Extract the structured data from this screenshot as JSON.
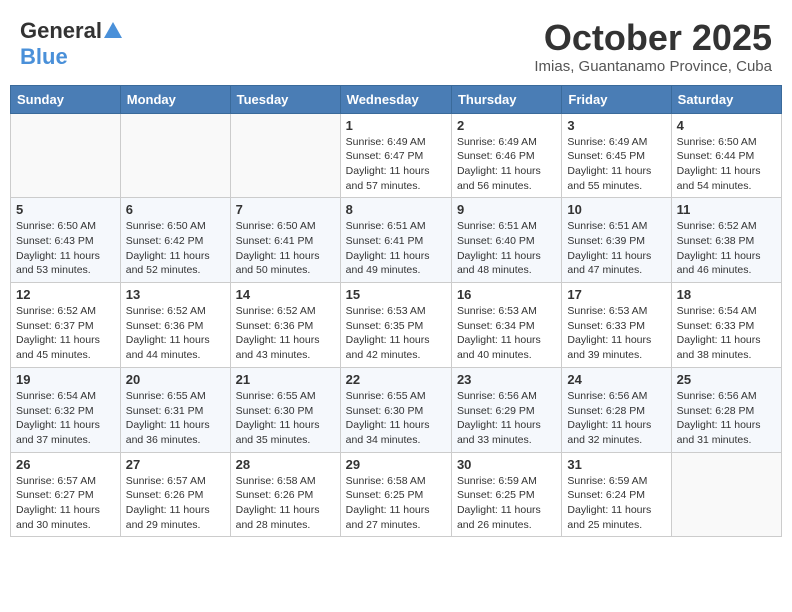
{
  "header": {
    "logo_general": "General",
    "logo_blue": "Blue",
    "month": "October 2025",
    "location": "Imias, Guantanamo Province, Cuba"
  },
  "days_of_week": [
    "Sunday",
    "Monday",
    "Tuesday",
    "Wednesday",
    "Thursday",
    "Friday",
    "Saturday"
  ],
  "weeks": [
    [
      {
        "day": "",
        "text": ""
      },
      {
        "day": "",
        "text": ""
      },
      {
        "day": "",
        "text": ""
      },
      {
        "day": "1",
        "text": "Sunrise: 6:49 AM\nSunset: 6:47 PM\nDaylight: 11 hours and 57 minutes."
      },
      {
        "day": "2",
        "text": "Sunrise: 6:49 AM\nSunset: 6:46 PM\nDaylight: 11 hours and 56 minutes."
      },
      {
        "day": "3",
        "text": "Sunrise: 6:49 AM\nSunset: 6:45 PM\nDaylight: 11 hours and 55 minutes."
      },
      {
        "day": "4",
        "text": "Sunrise: 6:50 AM\nSunset: 6:44 PM\nDaylight: 11 hours and 54 minutes."
      }
    ],
    [
      {
        "day": "5",
        "text": "Sunrise: 6:50 AM\nSunset: 6:43 PM\nDaylight: 11 hours and 53 minutes."
      },
      {
        "day": "6",
        "text": "Sunrise: 6:50 AM\nSunset: 6:42 PM\nDaylight: 11 hours and 52 minutes."
      },
      {
        "day": "7",
        "text": "Sunrise: 6:50 AM\nSunset: 6:41 PM\nDaylight: 11 hours and 50 minutes."
      },
      {
        "day": "8",
        "text": "Sunrise: 6:51 AM\nSunset: 6:41 PM\nDaylight: 11 hours and 49 minutes."
      },
      {
        "day": "9",
        "text": "Sunrise: 6:51 AM\nSunset: 6:40 PM\nDaylight: 11 hours and 48 minutes."
      },
      {
        "day": "10",
        "text": "Sunrise: 6:51 AM\nSunset: 6:39 PM\nDaylight: 11 hours and 47 minutes."
      },
      {
        "day": "11",
        "text": "Sunrise: 6:52 AM\nSunset: 6:38 PM\nDaylight: 11 hours and 46 minutes."
      }
    ],
    [
      {
        "day": "12",
        "text": "Sunrise: 6:52 AM\nSunset: 6:37 PM\nDaylight: 11 hours and 45 minutes."
      },
      {
        "day": "13",
        "text": "Sunrise: 6:52 AM\nSunset: 6:36 PM\nDaylight: 11 hours and 44 minutes."
      },
      {
        "day": "14",
        "text": "Sunrise: 6:52 AM\nSunset: 6:36 PM\nDaylight: 11 hours and 43 minutes."
      },
      {
        "day": "15",
        "text": "Sunrise: 6:53 AM\nSunset: 6:35 PM\nDaylight: 11 hours and 42 minutes."
      },
      {
        "day": "16",
        "text": "Sunrise: 6:53 AM\nSunset: 6:34 PM\nDaylight: 11 hours and 40 minutes."
      },
      {
        "day": "17",
        "text": "Sunrise: 6:53 AM\nSunset: 6:33 PM\nDaylight: 11 hours and 39 minutes."
      },
      {
        "day": "18",
        "text": "Sunrise: 6:54 AM\nSunset: 6:33 PM\nDaylight: 11 hours and 38 minutes."
      }
    ],
    [
      {
        "day": "19",
        "text": "Sunrise: 6:54 AM\nSunset: 6:32 PM\nDaylight: 11 hours and 37 minutes."
      },
      {
        "day": "20",
        "text": "Sunrise: 6:55 AM\nSunset: 6:31 PM\nDaylight: 11 hours and 36 minutes."
      },
      {
        "day": "21",
        "text": "Sunrise: 6:55 AM\nSunset: 6:30 PM\nDaylight: 11 hours and 35 minutes."
      },
      {
        "day": "22",
        "text": "Sunrise: 6:55 AM\nSunset: 6:30 PM\nDaylight: 11 hours and 34 minutes."
      },
      {
        "day": "23",
        "text": "Sunrise: 6:56 AM\nSunset: 6:29 PM\nDaylight: 11 hours and 33 minutes."
      },
      {
        "day": "24",
        "text": "Sunrise: 6:56 AM\nSunset: 6:28 PM\nDaylight: 11 hours and 32 minutes."
      },
      {
        "day": "25",
        "text": "Sunrise: 6:56 AM\nSunset: 6:28 PM\nDaylight: 11 hours and 31 minutes."
      }
    ],
    [
      {
        "day": "26",
        "text": "Sunrise: 6:57 AM\nSunset: 6:27 PM\nDaylight: 11 hours and 30 minutes."
      },
      {
        "day": "27",
        "text": "Sunrise: 6:57 AM\nSunset: 6:26 PM\nDaylight: 11 hours and 29 minutes."
      },
      {
        "day": "28",
        "text": "Sunrise: 6:58 AM\nSunset: 6:26 PM\nDaylight: 11 hours and 28 minutes."
      },
      {
        "day": "29",
        "text": "Sunrise: 6:58 AM\nSunset: 6:25 PM\nDaylight: 11 hours and 27 minutes."
      },
      {
        "day": "30",
        "text": "Sunrise: 6:59 AM\nSunset: 6:25 PM\nDaylight: 11 hours and 26 minutes."
      },
      {
        "day": "31",
        "text": "Sunrise: 6:59 AM\nSunset: 6:24 PM\nDaylight: 11 hours and 25 minutes."
      },
      {
        "day": "",
        "text": ""
      }
    ]
  ]
}
